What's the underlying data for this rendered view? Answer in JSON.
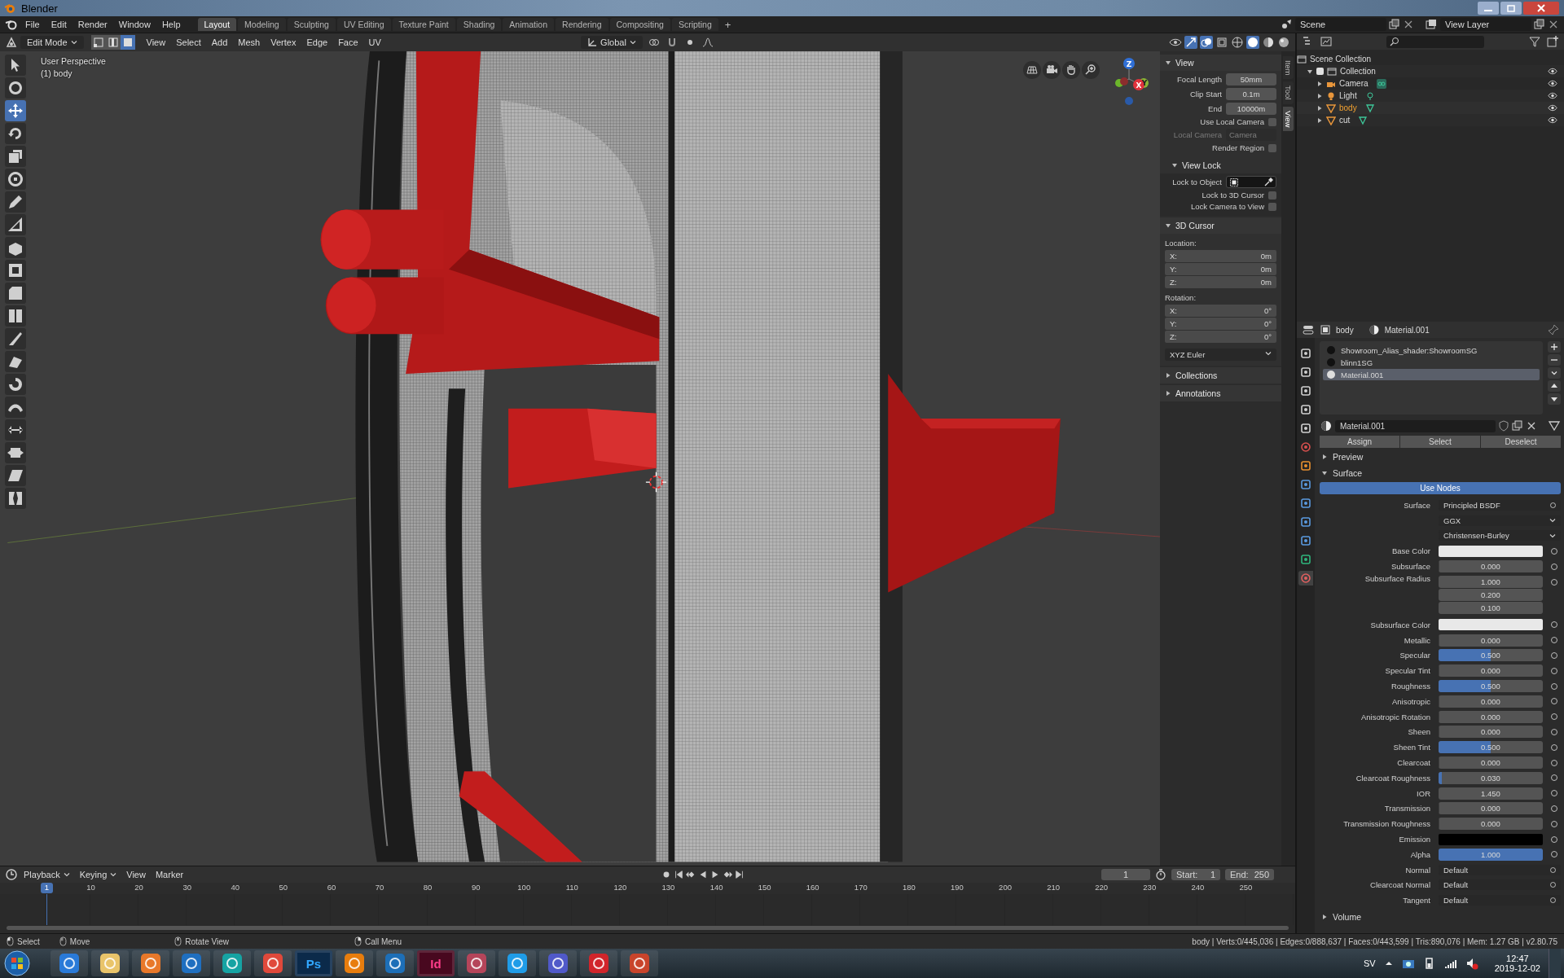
{
  "title_bar": {
    "title": "Blender"
  },
  "menu_bar": {
    "menus": [
      "File",
      "Edit",
      "Render",
      "Window",
      "Help"
    ],
    "workspaces": [
      {
        "label": "Layout",
        "selected": true
      },
      {
        "label": "Modeling",
        "selected": false
      },
      {
        "label": "Sculpting",
        "selected": false
      },
      {
        "label": "UV Editing",
        "selected": false
      },
      {
        "label": "Texture Paint",
        "selected": false
      },
      {
        "label": "Shading",
        "selected": false
      },
      {
        "label": "Animation",
        "selected": false
      },
      {
        "label": "Rendering",
        "selected": false
      },
      {
        "label": "Compositing",
        "selected": false
      },
      {
        "label": "Scripting",
        "selected": false
      }
    ],
    "add_tab": "+",
    "scene": "Scene",
    "view_layer": "View Layer"
  },
  "viewport": {
    "header": {
      "mode": "Edit Mode",
      "select_modes": [
        {
          "kind": "vertex",
          "selected": false
        },
        {
          "kind": "edge",
          "selected": false
        },
        {
          "kind": "face",
          "selected": true
        }
      ],
      "menus": [
        "View",
        "Select",
        "Add",
        "Mesh",
        "Vertex",
        "Edge",
        "Face",
        "UV"
      ],
      "orientation": "Global"
    },
    "tools": [
      {
        "kind": "select",
        "selected": false
      },
      {
        "kind": "cursor",
        "selected": false
      },
      {
        "kind": "move",
        "selected": true
      },
      {
        "kind": "rotate",
        "selected": false
      },
      {
        "kind": "scale",
        "selected": false
      },
      {
        "kind": "transform",
        "selected": false
      },
      {
        "kind": "annotate",
        "selected": false
      },
      {
        "kind": "measure",
        "selected": false
      },
      {
        "kind": "extrude",
        "selected": false
      },
      {
        "kind": "inset",
        "selected": false
      },
      {
        "kind": "bevel",
        "selected": false
      },
      {
        "kind": "loopcut",
        "selected": false
      },
      {
        "kind": "knife",
        "selected": false
      },
      {
        "kind": "polybuild",
        "selected": false
      },
      {
        "kind": "spin",
        "selected": false
      },
      {
        "kind": "smooth",
        "selected": false
      },
      {
        "kind": "slide",
        "selected": false
      },
      {
        "kind": "shrink",
        "selected": false
      },
      {
        "kind": "shear",
        "selected": false
      },
      {
        "kind": "rip",
        "selected": false
      }
    ],
    "overlay": {
      "view_name": "User Perspective",
      "object": "(1) body"
    },
    "gizmo": {
      "axes": [
        "Z",
        "X",
        "Y"
      ]
    },
    "sidebar": {
      "tabs": [
        {
          "label": "Item",
          "selected": false
        },
        {
          "label": "Tool",
          "selected": false
        },
        {
          "label": "View",
          "selected": true
        }
      ],
      "view": {
        "title": "View",
        "expanded": true,
        "fields": [
          {
            "label": "Focal Length",
            "value": "50mm"
          },
          {
            "label": "Clip Start",
            "value": "0.1m"
          },
          {
            "label": "End",
            "value": "10000m"
          }
        ],
        "use_local_camera": {
          "label": "Use Local Camera",
          "checked": false
        },
        "local_camera": {
          "label": "Local Camera",
          "value": "Camera",
          "disabled": true
        },
        "render_region": {
          "label": "Render Region",
          "checked": false
        }
      },
      "view_lock": {
        "title": "View Lock",
        "expanded": true,
        "lock_to_object": "Lock to Object",
        "checks": [
          {
            "label": "Lock to 3D Cursor",
            "checked": false
          },
          {
            "label": "Lock Camera to View",
            "checked": false
          }
        ]
      },
      "cursor": {
        "title": "3D Cursor",
        "expanded": true,
        "location_label": "Location:",
        "location": [
          {
            "axis": "X:",
            "value": "0m"
          },
          {
            "axis": "Y:",
            "value": "0m"
          },
          {
            "axis": "Z:",
            "value": "0m"
          }
        ],
        "rotation_label": "Rotation:",
        "rotation": [
          {
            "axis": "X:",
            "value": "0°"
          },
          {
            "axis": "Y:",
            "value": "0°"
          },
          {
            "axis": "Z:",
            "value": "0°"
          }
        ],
        "rotation_mode": "XYZ Euler"
      },
      "more_panels": [
        {
          "title": "Collections",
          "expanded": false
        },
        {
          "title": "Annotations",
          "expanded": false
        }
      ]
    }
  },
  "timeline": {
    "menus": [
      {
        "label": "Playback",
        "dropdown": true
      },
      {
        "label": "Keying",
        "dropdown": true
      },
      {
        "label": "View",
        "dropdown": false
      },
      {
        "label": "Marker",
        "dropdown": false
      }
    ],
    "current_frame": "1",
    "start_label": "Start:",
    "start": "1",
    "end_label": "End:",
    "end": "250",
    "ruler_current": "1",
    "ruler": [
      "10",
      "20",
      "30",
      "40",
      "50",
      "60",
      "70",
      "80",
      "90",
      "100",
      "110",
      "120",
      "130",
      "140",
      "150",
      "160",
      "170",
      "180",
      "190",
      "200",
      "210",
      "220",
      "230",
      "240",
      "250"
    ]
  },
  "status_bar": {
    "hints": [
      {
        "kind": "left",
        "label": "Select"
      },
      {
        "kind": "drag",
        "label": "Move"
      },
      {
        "kind": "middle",
        "label": "Rotate View"
      },
      {
        "kind": "right",
        "label": "Call Menu"
      }
    ],
    "stats": "body | Verts:0/445,036 | Edges:0/888,637 | Faces:0/443,599 | Tris:890,076 | Mem: 1.27 GB | v2.80.75"
  },
  "outliner": {
    "root": "Scene Collection",
    "tree": [
      {
        "label": "Collection",
        "kind": "collection",
        "checked": true,
        "expanded": true,
        "children": [
          {
            "label": "Camera",
            "kind": "camera",
            "selected": false,
            "expanded": false
          },
          {
            "label": "Light",
            "kind": "light",
            "selected": false,
            "expanded": false
          },
          {
            "label": "body",
            "kind": "mesh",
            "selected": true,
            "expanded": false
          },
          {
            "label": "cut",
            "kind": "mesh",
            "selected": false,
            "expanded": false
          }
        ]
      }
    ]
  },
  "properties": {
    "tabs": [
      {
        "kind": "tool",
        "selected": false
      },
      {
        "kind": "render",
        "selected": false
      },
      {
        "kind": "output",
        "selected": false
      },
      {
        "kind": "view-layer",
        "selected": false
      },
      {
        "kind": "scene",
        "selected": false
      },
      {
        "kind": "world",
        "selected": false
      },
      {
        "kind": "object",
        "selected": false
      },
      {
        "kind": "modifier",
        "selected": false
      },
      {
        "kind": "particles",
        "selected": false
      },
      {
        "kind": "physics",
        "selected": false
      },
      {
        "kind": "constraints",
        "selected": false
      },
      {
        "kind": "data",
        "selected": false
      },
      {
        "kind": "material",
        "selected": true
      }
    ],
    "object": "body",
    "material": "Material.001",
    "slots": [
      {
        "label": "Showroom_Alias_shader:ShowroomSG",
        "selected": false
      },
      {
        "label": "blinn1SG",
        "selected": false
      },
      {
        "label": "Material.001",
        "selected": true
      }
    ],
    "material_field": "Material.001",
    "buttons": [
      "Assign",
      "Select",
      "Deselect"
    ],
    "preview": {
      "title": "Preview",
      "expanded": false
    },
    "surface": {
      "title": "Surface",
      "expanded": true,
      "use_nodes": {
        "label": "Use Nodes",
        "on": true
      },
      "rows": [
        {
          "kind": "shader",
          "label": "Surface",
          "value": "Principled BSDF"
        },
        {
          "kind": "enum",
          "value": "GGX"
        },
        {
          "kind": "enum",
          "value": "Christensen-Burley"
        },
        {
          "kind": "color",
          "label": "Base Color",
          "color": "#e8e8e8"
        },
        {
          "kind": "slider",
          "label": "Subsurface",
          "value": "0.000",
          "level": 0
        },
        {
          "kind": "vector",
          "label": "Subsurface Radius",
          "values": [
            "1.000",
            "0.200",
            "0.100"
          ]
        },
        {
          "kind": "color",
          "label": "Subsurface Color",
          "color": "#e8e8e8"
        },
        {
          "kind": "slider",
          "label": "Metallic",
          "value": "0.000",
          "level": 0
        },
        {
          "kind": "slider",
          "label": "Specular",
          "value": "0.500",
          "level": 0.5
        },
        {
          "kind": "slider",
          "label": "Specular Tint",
          "value": "0.000",
          "level": 0
        },
        {
          "kind": "slider",
          "label": "Roughness",
          "value": "0.500",
          "level": 0.5
        },
        {
          "kind": "slider",
          "label": "Anisotropic",
          "value": "0.000",
          "level": 0
        },
        {
          "kind": "slider",
          "label": "Anisotropic Rotation",
          "value": "0.000",
          "level": 0
        },
        {
          "kind": "slider",
          "label": "Sheen",
          "value": "0.000",
          "level": 0
        },
        {
          "kind": "slider",
          "label": "Sheen Tint",
          "value": "0.500",
          "level": 0.5
        },
        {
          "kind": "slider",
          "label": "Clearcoat",
          "value": "0.000",
          "level": 0
        },
        {
          "kind": "slider",
          "label": "Clearcoat Roughness",
          "value": "0.030",
          "level": 0.03
        },
        {
          "kind": "number",
          "label": "IOR",
          "value": "1.450"
        },
        {
          "kind": "slider",
          "label": "Transmission",
          "value": "0.000",
          "level": 0
        },
        {
          "kind": "slider",
          "label": "Transmission Roughness",
          "value": "0.000",
          "level": 0
        },
        {
          "kind": "color",
          "label": "Emission",
          "color": "#000000"
        },
        {
          "kind": "slider",
          "label": "Alpha",
          "value": "1.000",
          "level": 1
        },
        {
          "kind": "link",
          "label": "Normal",
          "value": "Default"
        },
        {
          "kind": "link",
          "label": "Clearcoat Normal",
          "value": "Default"
        },
        {
          "kind": "link",
          "label": "Tangent",
          "value": "Default"
        }
      ]
    },
    "volume": {
      "title": "Volume",
      "expanded": false
    }
  },
  "taskbar": {
    "apps": [
      {
        "kind": "browser"
      },
      {
        "kind": "folder"
      },
      {
        "kind": "player"
      },
      {
        "kind": "mail"
      },
      {
        "kind": "maya"
      },
      {
        "kind": "chrome"
      },
      {
        "kind": "photoshop",
        "label": "Ps"
      },
      {
        "kind": "blender"
      },
      {
        "kind": "globe"
      },
      {
        "kind": "indesign",
        "label": "Id"
      },
      {
        "kind": "snip"
      },
      {
        "kind": "skype"
      },
      {
        "kind": "teams"
      },
      {
        "kind": "acrobat"
      },
      {
        "kind": "powerpoint"
      }
    ],
    "language": "SV",
    "time": "12:47",
    "date": "2019-12-02"
  }
}
